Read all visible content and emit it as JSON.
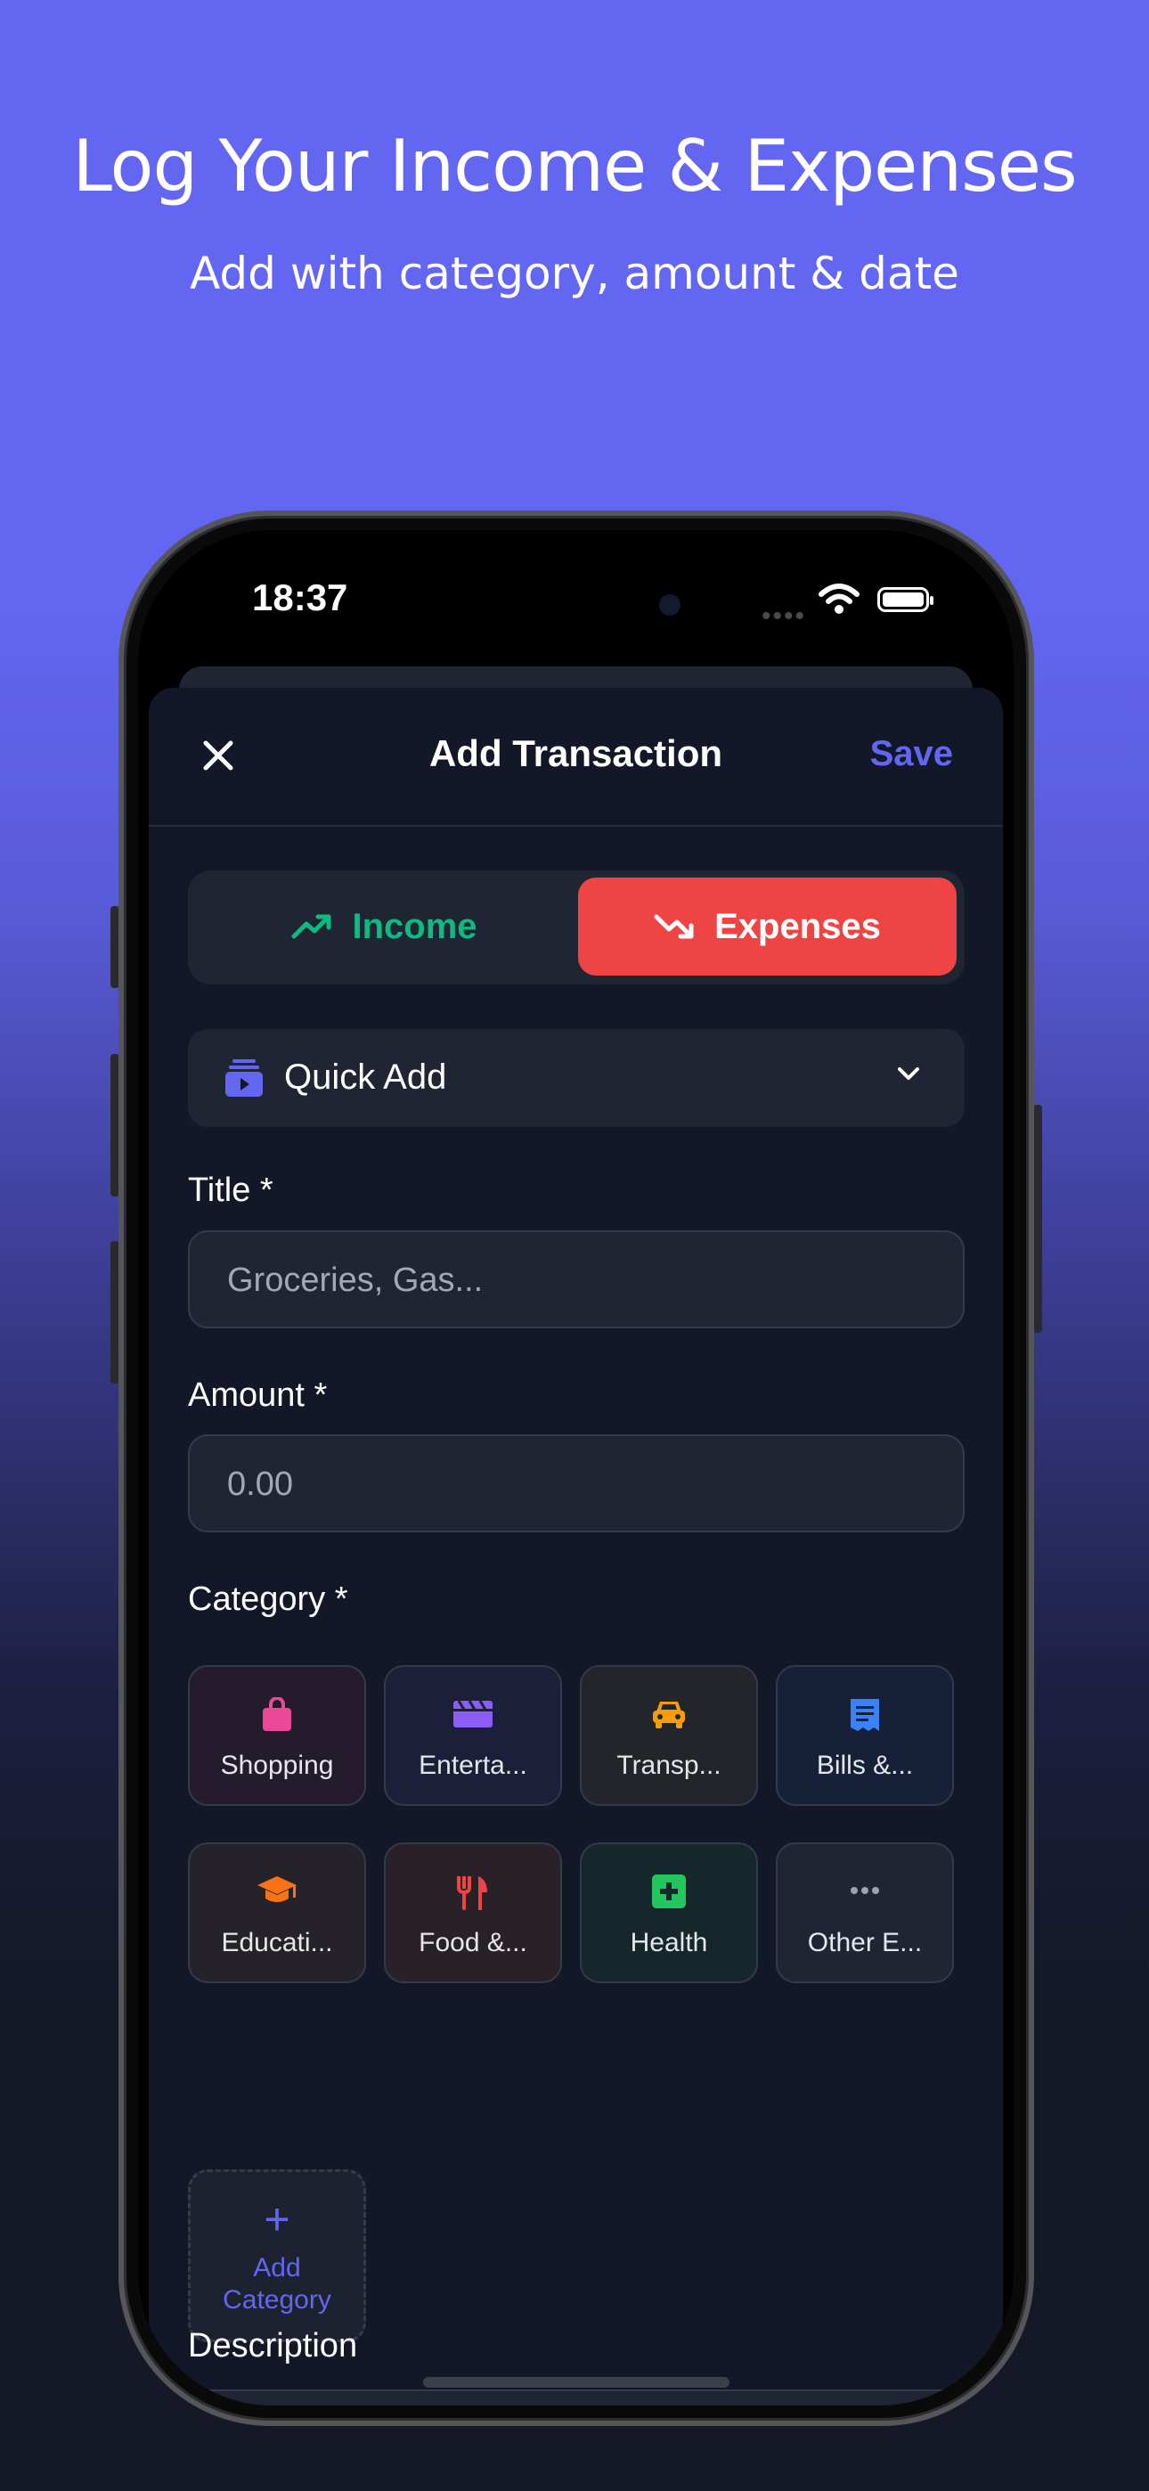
{
  "hero": {
    "title": "Log Your Income & Expenses",
    "subtitle": "Add with category, amount & date"
  },
  "status_bar": {
    "time": "18:37"
  },
  "header": {
    "title": "Add Transaction",
    "save_label": "Save",
    "close_icon": "close-icon"
  },
  "type_toggle": {
    "income_label": "Income",
    "expenses_label": "Expenses",
    "selected": "Expenses"
  },
  "quick_add": {
    "label": "Quick Add"
  },
  "form": {
    "title_label": "Title *",
    "title_placeholder": "Groceries, Gas...",
    "amount_label": "Amount *",
    "amount_placeholder": "0.00",
    "category_label": "Category *",
    "description_label": "Description"
  },
  "categories": [
    {
      "label": "Shopping",
      "icon": "shopping-bag-icon",
      "color": "#ec4899"
    },
    {
      "label": "Enterta...",
      "icon": "clapperboard-icon",
      "color": "#8b5cf6"
    },
    {
      "label": "Transp...",
      "icon": "car-icon",
      "color": "#f59e0b"
    },
    {
      "label": "Bills &...",
      "icon": "receipt-icon",
      "color": "#3b82f6"
    },
    {
      "label": "Educati...",
      "icon": "graduation-cap-icon",
      "color": "#f97316"
    },
    {
      "label": "Food &...",
      "icon": "fork-knife-icon",
      "color": "#ef4444"
    },
    {
      "label": "Health",
      "icon": "medical-cross-icon",
      "color": "#22c55e"
    },
    {
      "label": "Other E...",
      "icon": "more-dots-icon",
      "color": "#9ca3af"
    }
  ],
  "add_category": {
    "line1": "Add",
    "line2": "Category"
  },
  "colors": {
    "accent": "#6366f1",
    "income": "#10b981",
    "expense": "#ef4444",
    "background": "#121827",
    "surface": "#1f2533"
  }
}
